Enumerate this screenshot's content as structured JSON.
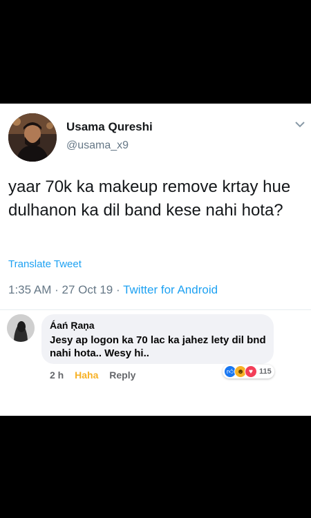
{
  "tweet": {
    "author_name": "Usama Qureshi",
    "handle": "@usama_x9",
    "text": "yaar 70k ka makeup remove krtay hue dulhanon ka dil band kese nahi hota?",
    "translate_label": "Translate Tweet",
    "time": "1:35 AM",
    "date": "27 Oct 19",
    "source": "Twitter for Android",
    "separator": "·",
    "icons": {
      "more": "chevron-down-icon",
      "avatar": "profile-photo"
    }
  },
  "comment": {
    "author": "Áań Ŗaņa",
    "text": "Jesy ap logon ka 70 lac ka jahez lety dil bnd nahi hota.. Wesy hi..",
    "time": "2 h",
    "reaction_label": "Haha",
    "reply_label": "Reply",
    "reaction_count": "115",
    "reaction_icons": [
      "like-icon",
      "haha-icon",
      "love-icon"
    ]
  },
  "colors": {
    "accent": "#1da1f2",
    "haha": "#f7b125",
    "like": "#1877f2",
    "love": "#f33e58"
  }
}
